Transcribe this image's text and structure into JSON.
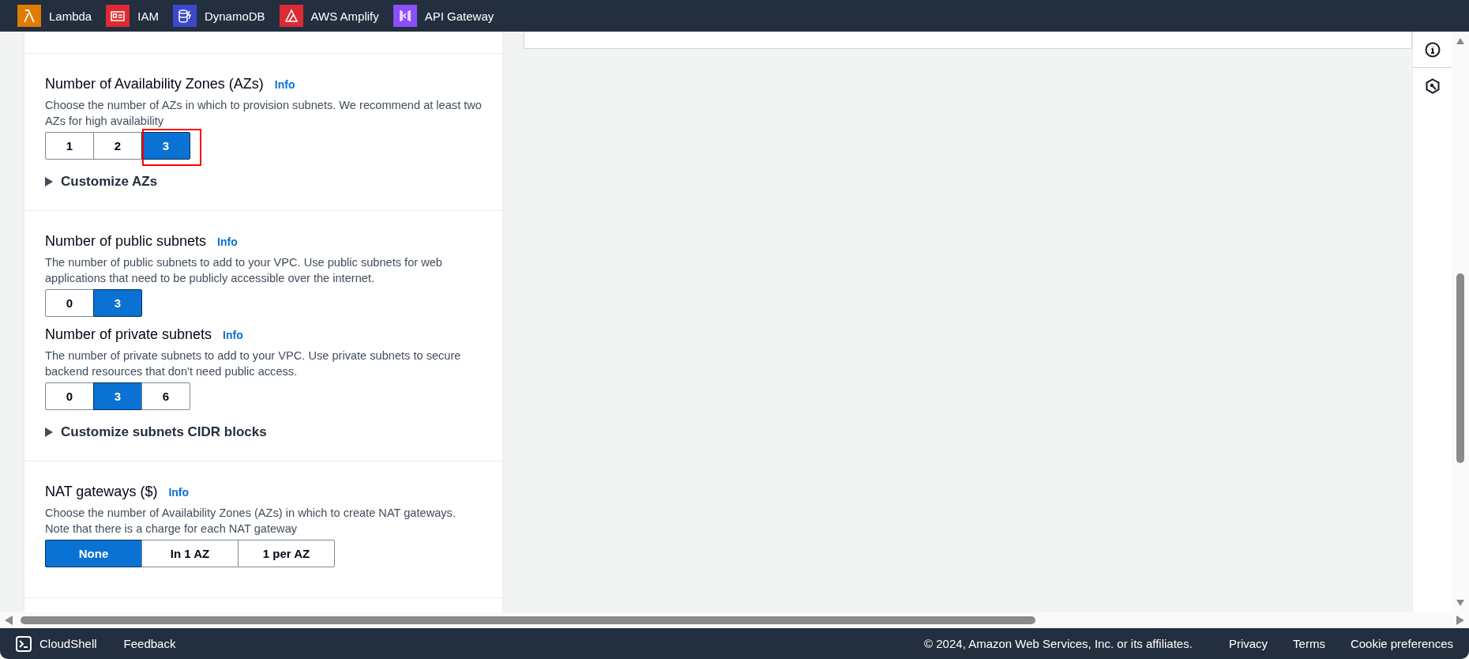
{
  "services": [
    {
      "name": "Lambda",
      "kind": "lambda",
      "color": "#e07b00"
    },
    {
      "name": "IAM",
      "kind": "iam",
      "color": "#dd2a33"
    },
    {
      "name": "DynamoDB",
      "kind": "dynamodb",
      "color": "#3b48cc"
    },
    {
      "name": "AWS Amplify",
      "kind": "amplify",
      "color": "#dd2a33"
    },
    {
      "name": "API Gateway",
      "kind": "apigateway",
      "color": "#8c4fff"
    }
  ],
  "sections": [
    {
      "fields": [
        {
          "title": "Number of Availability Zones (AZs)",
          "info": "Info",
          "description": "Choose the number of AZs in which to provision subnets. We recommend at least two AZs for high availability",
          "highlighted": true,
          "wide": false,
          "options": [
            {
              "label": "1",
              "selected": false
            },
            {
              "label": "2",
              "selected": false
            },
            {
              "label": "3",
              "selected": true
            }
          ]
        }
      ],
      "expander": {
        "label": "Customize AZs",
        "expanded": false
      }
    },
    {
      "fields": [
        {
          "title": "Number of public subnets",
          "info": "Info",
          "description": "The number of public subnets to add to your VPC. Use public subnets for web applications that need to be publicly accessible over the internet.",
          "highlighted": false,
          "wide": false,
          "options": [
            {
              "label": "0",
              "selected": false
            },
            {
              "label": "3",
              "selected": true
            }
          ]
        },
        {
          "title": "Number of private subnets",
          "info": "Info",
          "description": "The number of private subnets to add to your VPC. Use private subnets to secure backend resources that don't need public access.",
          "highlighted": false,
          "wide": false,
          "options": [
            {
              "label": "0",
              "selected": false
            },
            {
              "label": "3",
              "selected": true
            },
            {
              "label": "6",
              "selected": false
            }
          ]
        }
      ],
      "expander": {
        "label": "Customize subnets CIDR blocks",
        "expanded": false
      }
    },
    {
      "fields": [
        {
          "title": "NAT gateways ($)",
          "info": "Info",
          "description": "Choose the number of Availability Zones (AZs) in which to create NAT gateways. Note that there is a charge for each NAT gateway",
          "highlighted": false,
          "wide": true,
          "options": [
            {
              "label": "None",
              "selected": true
            },
            {
              "label": "In 1 AZ",
              "selected": false
            },
            {
              "label": "1 per AZ",
              "selected": false
            }
          ]
        }
      ]
    }
  ],
  "footer": {
    "cloudshell": "CloudShell",
    "feedback": "Feedback",
    "copyright": "© 2024, Amazon Web Services, Inc. or its affiliates.",
    "links": [
      "Privacy",
      "Terms",
      "Cookie preferences"
    ]
  }
}
